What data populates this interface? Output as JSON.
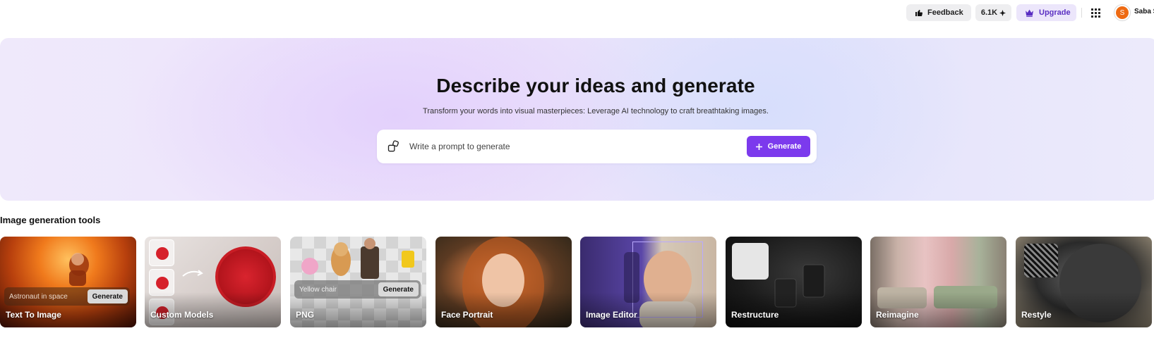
{
  "topbar": {
    "feedback_label": "Feedback",
    "credits_label": "6.1K",
    "upgrade_label": "Upgrade",
    "avatar_initial": "S",
    "user_name": "Saba S"
  },
  "hero": {
    "title": "Describe your ideas and generate",
    "subtitle": "Transform your words into visual masterpieces: Leverage AI technology to craft breathtaking images.",
    "prompt_placeholder": "Write a prompt to generate",
    "generate_label": "Generate"
  },
  "tools": {
    "section_title": "Image generation tools",
    "cards": [
      {
        "label": "Text To Image",
        "sample_prompt": "Astronaut in space",
        "button_label": "Generate"
      },
      {
        "label": "Custom Models"
      },
      {
        "label": "PNG",
        "sample_prompt": "Yellow chair",
        "button_label": "Generate"
      },
      {
        "label": "Face Portrait"
      },
      {
        "label": "Image Editor"
      },
      {
        "label": "Restructure"
      },
      {
        "label": "Reimagine"
      },
      {
        "label": "Restyle"
      }
    ]
  },
  "colors": {
    "accent": "#7c3aed",
    "avatar": "#ee6a12",
    "upgrade_bg": "#ece6fb"
  },
  "icons": [
    "thumbs-up-icon",
    "sparkle-icon",
    "crown-icon",
    "apps-grid-icon",
    "shapes-icon",
    "plus-icon"
  ]
}
